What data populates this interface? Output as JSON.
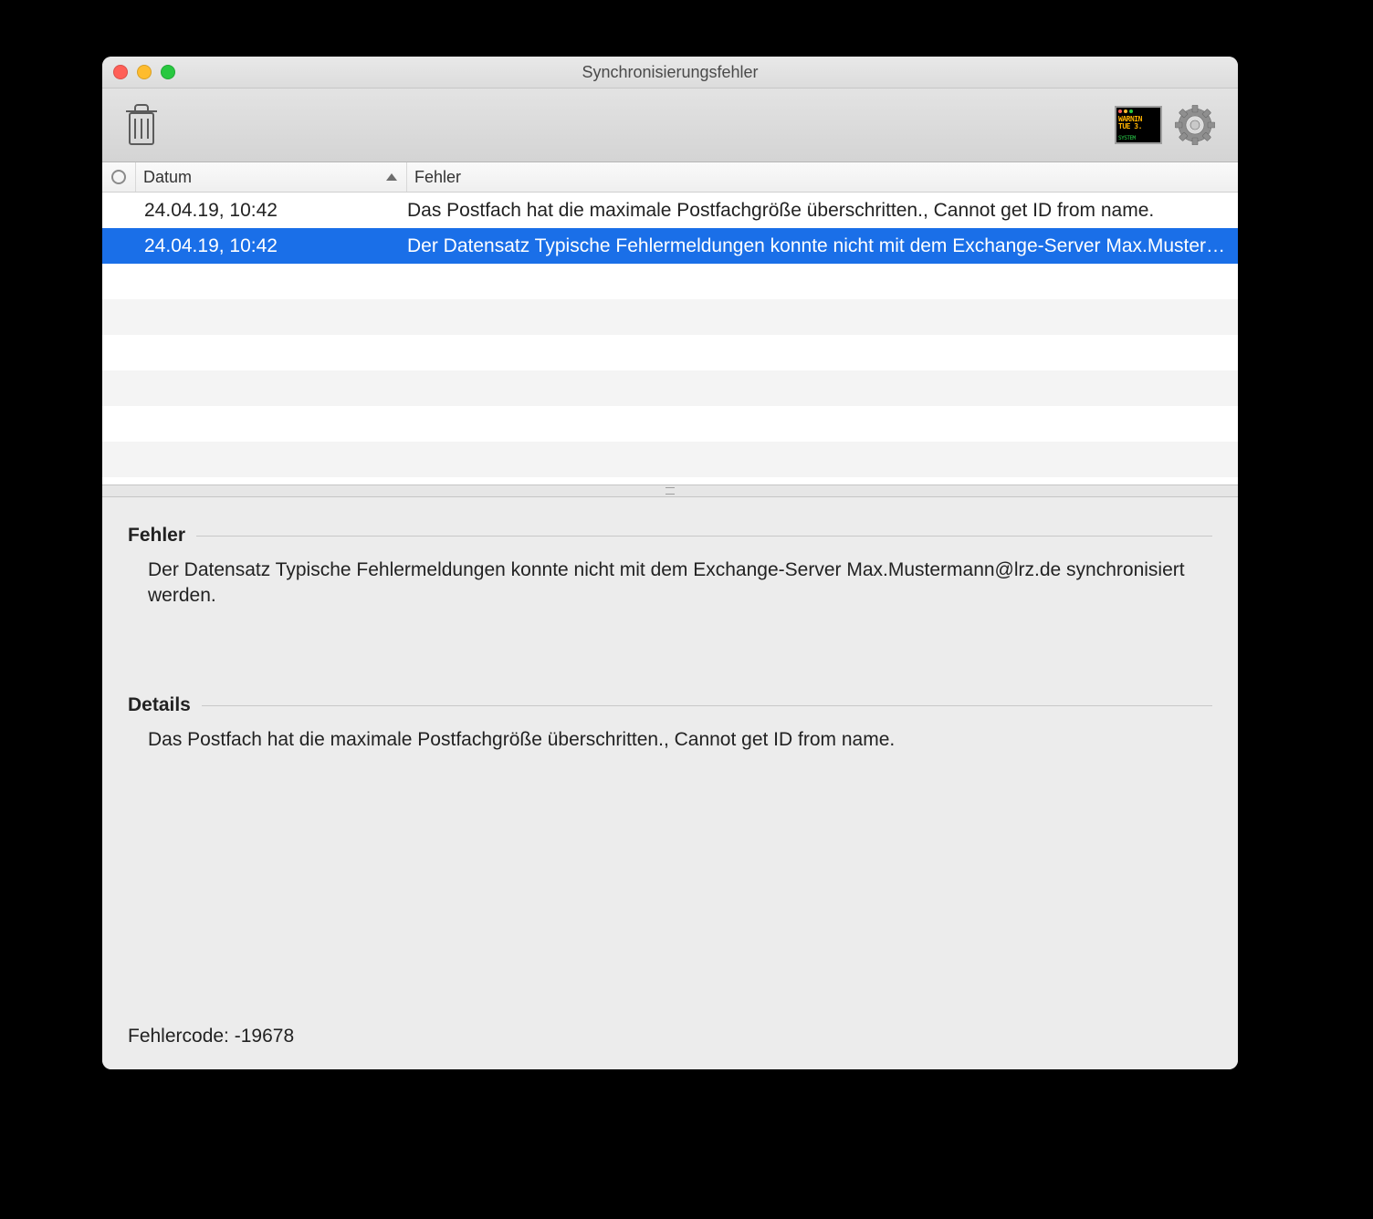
{
  "window": {
    "title": "Synchronisierungsfehler"
  },
  "toolbar": {
    "trash_name": "trash-icon",
    "logs_name": "warning-log-icon",
    "gear_name": "gear-icon"
  },
  "table": {
    "headers": {
      "date": "Datum",
      "error": "Fehler"
    },
    "sort_column": "date",
    "sort_direction": "asc",
    "rows": [
      {
        "date": "24.04.19, 10:42",
        "error": "Das Postfach hat die maximale Postfachgröße überschritten., Cannot get ID from name.",
        "selected": false
      },
      {
        "date": "24.04.19, 10:42",
        "error": "Der Datensatz Typische Fehlermeldungen konnte nicht mit dem Exchange-Server Max.Mustermann@lrz.de synchronisiert werden.",
        "selected": true
      }
    ],
    "blank_rows": 7
  },
  "details": {
    "error_label": "Fehler",
    "error_body": "Der Datensatz Typische Fehlermeldungen konnte nicht mit dem Exchange-Server Max.Mustermann@lrz.de synchronisiert werden.",
    "details_label": "Details",
    "details_body": "Das Postfach hat die maximale Postfachgröße überschritten., Cannot get ID from name.",
    "errorcode_label": "Fehlercode:",
    "errorcode_value": "-19678"
  }
}
